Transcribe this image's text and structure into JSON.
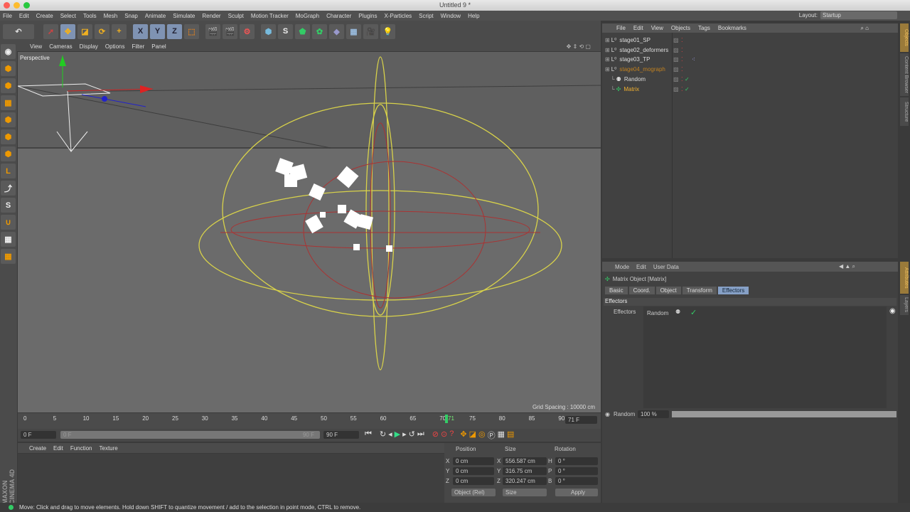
{
  "window": {
    "title": "Untitled 9 *"
  },
  "menu": [
    "File",
    "Edit",
    "Create",
    "Select",
    "Tools",
    "Mesh",
    "Snap",
    "Animate",
    "Simulate",
    "Render",
    "Sculpt",
    "Motion Tracker",
    "MoGraph",
    "Character",
    "Plugins",
    "X-Particles",
    "Script",
    "Window",
    "Help"
  ],
  "layout": {
    "label": "Layout:",
    "value": "Startup"
  },
  "toolbar": {
    "x": "X",
    "y": "Y",
    "z": "Z"
  },
  "viewport": {
    "menu": [
      "View",
      "Cameras",
      "Display",
      "Options",
      "Filter",
      "Panel"
    ],
    "label": "Perspective",
    "grid_spacing": "Grid Spacing : 10000 cm"
  },
  "timeline": {
    "ticks": [
      "0",
      "5",
      "10",
      "15",
      "20",
      "25",
      "30",
      "35",
      "40",
      "45",
      "50",
      "55",
      "60",
      "65",
      "70",
      "75",
      "80",
      "85",
      "90"
    ],
    "current_frame": "71",
    "end_field": "71 F",
    "start": "0 F",
    "range_start": "0 F",
    "range_end": "90 F",
    "max": "90 F",
    "current_fraction": 0.789
  },
  "material": {
    "menu": [
      "Create",
      "Edit",
      "Function",
      "Texture"
    ]
  },
  "coords": {
    "headers": [
      "Position",
      "Size",
      "Rotation"
    ],
    "rows": [
      {
        "axis": "X",
        "pos": "0 cm",
        "saxis": "X",
        "size": "556.587 cm",
        "raxis": "H",
        "rot": "0 °"
      },
      {
        "axis": "Y",
        "pos": "0 cm",
        "saxis": "Y",
        "size": "316.75 cm",
        "raxis": "P",
        "rot": "0 °"
      },
      {
        "axis": "Z",
        "pos": "0 cm",
        "saxis": "Z",
        "size": "320.247 cm",
        "raxis": "B",
        "rot": "0 °"
      }
    ],
    "mode": "Object (Rel)",
    "size_mode": "Size",
    "apply": "Apply"
  },
  "objects": {
    "menu": [
      "File",
      "Edit",
      "View",
      "Objects",
      "Tags",
      "Bookmarks"
    ],
    "items": [
      {
        "name": "stage01_SP"
      },
      {
        "name": "stage02_deformers"
      },
      {
        "name": "stage03_TP"
      },
      {
        "name": "stage04_mograph"
      },
      {
        "name": "Random"
      },
      {
        "name": "Matrix"
      }
    ]
  },
  "attributes": {
    "menu": [
      "Mode",
      "Edit",
      "User Data"
    ],
    "title": "Matrix Object [Matrix]",
    "tabs": [
      "Basic",
      "Coord.",
      "Object",
      "Transform",
      "Effectors"
    ],
    "section": "Effectors",
    "field_label": "Effectors",
    "effector": "Random",
    "strength_label": "Random",
    "strength_value": "100 %",
    "strength": 1.0
  },
  "sidetabs": [
    "Objects",
    "Content Browser",
    "Structure",
    "Attributes",
    "Layers"
  ],
  "status": "Move: Click and drag to move elements. Hold down SHIFT to quantize movement / add to the selection in point mode, CTRL to remove.",
  "brand": "MAXON CINEMA 4D"
}
